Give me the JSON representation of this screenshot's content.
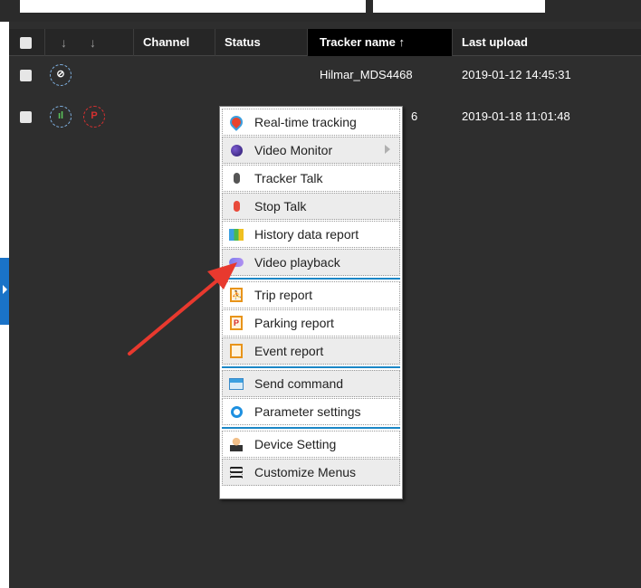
{
  "table": {
    "headers": {
      "channel": "Channel",
      "status": "Status",
      "tracker_name": "Tracker name ↑",
      "last_upload": "Last upload"
    },
    "sort_arrows": [
      "↓",
      "↓"
    ],
    "rows": [
      {
        "tracker_name": "Hilmar_MDS4468",
        "last_upload": "2019-01-12 14:45:31",
        "icons": [
          "signal-off-icon"
        ]
      },
      {
        "tracker_name_partial": "6",
        "last_upload": "2019-01-18 11:01:48",
        "icons": [
          "signal-bars-icon",
          "parking-icon"
        ]
      }
    ]
  },
  "context_menu": {
    "items": [
      {
        "label": "Real-time tracking",
        "icon": "map-pin-icon"
      },
      {
        "label": "Video Monitor",
        "icon": "globe-icon",
        "has_submenu": true
      },
      {
        "label": "Tracker Talk",
        "icon": "microphone-icon"
      },
      {
        "label": "Stop Talk",
        "icon": "microphone-red-icon"
      },
      {
        "label": "History data report",
        "icon": "map-icon"
      },
      {
        "label": "Video playback",
        "icon": "camera-icon"
      },
      {
        "label": "Trip report",
        "icon": "trip-report-icon"
      },
      {
        "label": "Parking report",
        "icon": "parking-report-icon"
      },
      {
        "label": "Event report",
        "icon": "event-report-icon"
      },
      {
        "label": "Send command",
        "icon": "command-icon"
      },
      {
        "label": "Parameter settings",
        "icon": "ring-icon"
      },
      {
        "label": "Device Setting",
        "icon": "user-icon"
      },
      {
        "label": "Customize Menus",
        "icon": "menu-icon"
      }
    ]
  },
  "row_icon_glyphs": {
    "signal_off": "⊘",
    "signal_bars": "ıl",
    "parking": "P"
  },
  "menu_icon_glyphs": {
    "trip": "⛹",
    "parking": "P"
  },
  "colors": {
    "panel_bg": "#2e2e2e",
    "header_bg": "#262626",
    "sorted_header_bg": "#000000",
    "accent_blue": "#1b87c6",
    "arrow_red": "#e8392e"
  }
}
